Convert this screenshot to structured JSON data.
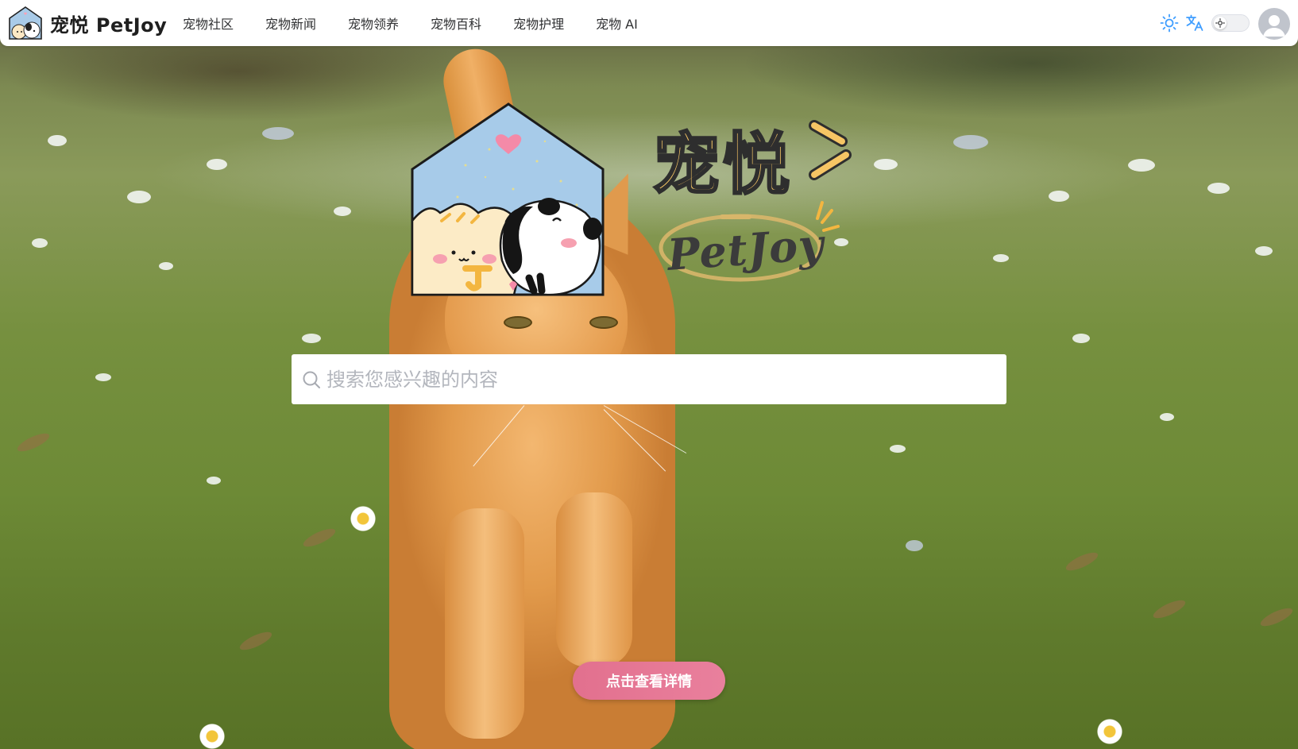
{
  "brand": {
    "name": "宠悦 PetJoy"
  },
  "nav": {
    "links": [
      "宠物社区",
      "宠物新闻",
      "宠物领养",
      "宠物百科",
      "宠物护理",
      "宠物 AI"
    ]
  },
  "toolbar": {
    "icons": [
      "sun-icon",
      "translate-icon",
      "theme-switch",
      "avatar"
    ]
  },
  "hero": {
    "title": "宠悦",
    "subtitle": "PetJoy"
  },
  "search": {
    "placeholder": "搜索您感兴趣的内容",
    "value": ""
  },
  "cta": {
    "label": "点击查看详情"
  },
  "colors": {
    "accent": "#409eff",
    "cta": "#e5758f",
    "title_yellow": "#f6c564"
  }
}
